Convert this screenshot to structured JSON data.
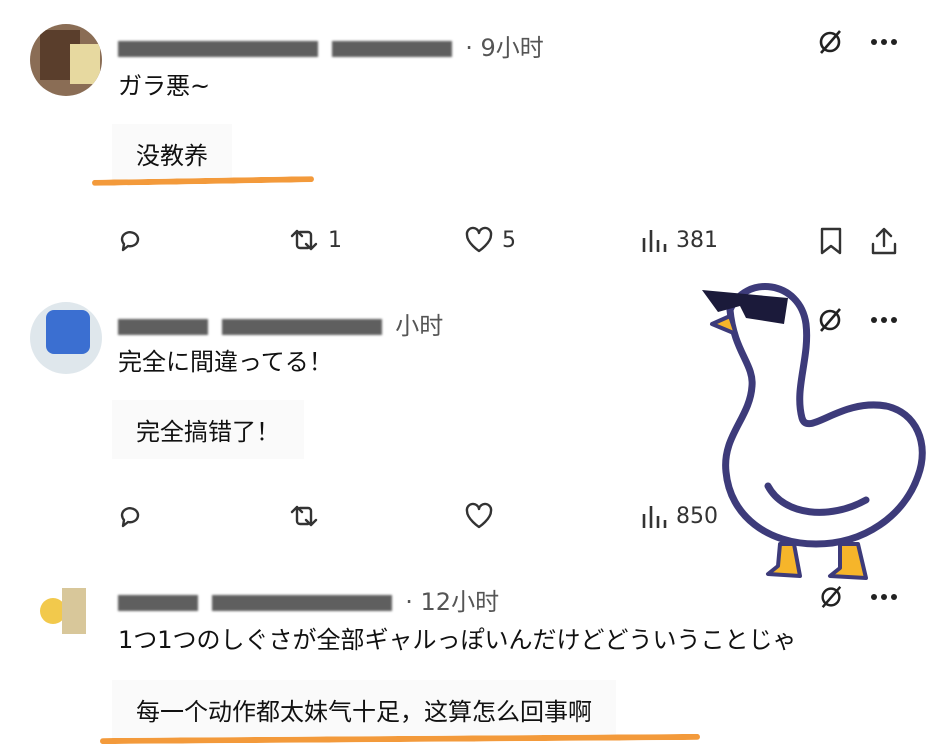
{
  "posts": [
    {
      "time": "· 9小时",
      "text": "ガラ悪~",
      "translation": "没教养",
      "retweet_count": "1",
      "like_count": "5",
      "view_count": "381"
    },
    {
      "time": "小时",
      "text": "完全に間違ってる！",
      "translation": "完全搞错了！",
      "retweet_count": "",
      "like_count": "",
      "view_count": "850"
    },
    {
      "time": "· 12小时",
      "text": "1つ1つのしぐさが全部ギャルっぽいんだけどどういうことじゃ",
      "translation": "每一个动作都太妹气十足，这算怎么回事啊"
    }
  ],
  "colors": {
    "underline": "#f39a3b",
    "duck_outline": "#3d3b7a",
    "duck_feet": "#f6b52a"
  },
  "icons": [
    "grok-icon",
    "more-icon",
    "reply-icon",
    "retweet-icon",
    "like-icon",
    "views-icon",
    "bookmark-icon",
    "share-icon"
  ]
}
